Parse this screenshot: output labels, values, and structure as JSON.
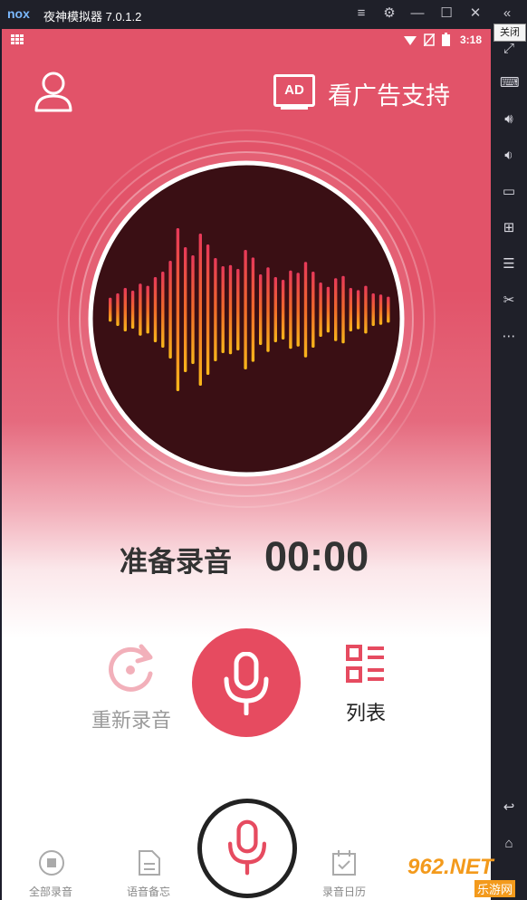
{
  "window": {
    "logo": "nox",
    "title": "夜神模拟器 7.0.1.2",
    "tooltip": "关闭"
  },
  "statusbar": {
    "time": "3:18"
  },
  "header": {
    "ad_icon_label": "AD",
    "ad_text": "看广告支持"
  },
  "recorder": {
    "status": "准备录音",
    "timer": "00:00",
    "rerecord_label": "重新录音",
    "list_label": "列表"
  },
  "bottom_nav": {
    "items": [
      {
        "label": "全部录音",
        "icon": "record-circle-icon"
      },
      {
        "label": "语音备忘",
        "icon": "note-icon"
      },
      {
        "label": "录音日历",
        "icon": "calendar-icon"
      }
    ]
  },
  "watermark": {
    "text": "962.NET",
    "sub": "乐游网"
  },
  "colors": {
    "accent": "#e64b60",
    "window_bg": "#1f2029"
  }
}
